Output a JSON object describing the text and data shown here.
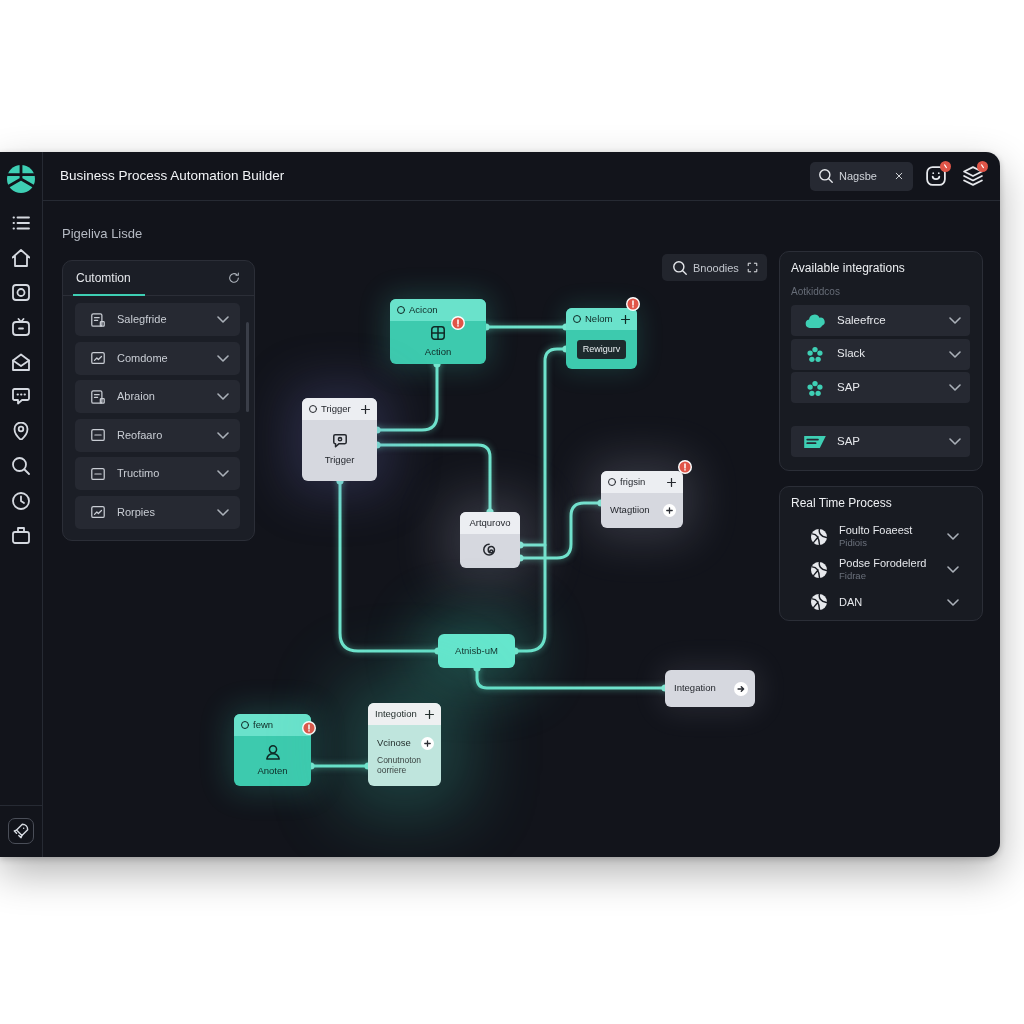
{
  "window": {
    "title": "Business Process Automation Builder"
  },
  "header": {
    "search": {
      "placeholder": "Nagsbe"
    },
    "buttons": [
      {
        "alert": true
      },
      {
        "alert": true
      }
    ]
  },
  "section_title": "Pigeliva Lisde",
  "left_panel": {
    "tabs": [
      {
        "label": "Cutomtion",
        "selected": true
      }
    ],
    "items": [
      {
        "label": "Salegfride",
        "expanded": false
      },
      {
        "label": "Comdome",
        "expanded": false
      },
      {
        "label": "Abraion",
        "expanded": false
      },
      {
        "label": "Reofaaro",
        "expanded": false
      },
      {
        "label": "Tructimo",
        "expanded": false
      },
      {
        "label": "Rorpies",
        "expanded": false
      }
    ]
  },
  "canvas": {
    "search": {
      "placeholder": "Bnoodies"
    },
    "nodes": [
      {
        "kind": "action",
        "header": "Acicon",
        "label": "Action",
        "alert": true
      },
      {
        "kind": "action",
        "header": "Nelom",
        "chip": "Rewigurv",
        "alert": true
      },
      {
        "kind": "trigger",
        "header": "Trigger",
        "label": "Trigger",
        "alert": false
      },
      {
        "kind": "trigger",
        "header": "Artqurovo",
        "alert": false
      },
      {
        "kind": "trigger",
        "header": "frigsin",
        "label": "Wtagtiion",
        "alert": true
      },
      {
        "kind": "highlight",
        "label": "Atnisb-uM",
        "alert": false
      },
      {
        "kind": "trigger",
        "label": "Integation",
        "alert": false
      },
      {
        "kind": "action",
        "header": "fewn",
        "label": "Anoten",
        "alert": true
      },
      {
        "kind": "integration",
        "header": "Integotion",
        "label": "Vcinose",
        "note": "Conutnoton oorriere",
        "alert": false
      }
    ]
  },
  "integrations": {
    "title": "Available integrations",
    "subtitle": "Aotkiddcos",
    "groups": [
      {
        "items": [
          {
            "label": "Saleefrce",
            "expanded": false
          },
          {
            "label": "Slack",
            "expanded": false
          },
          {
            "label": "SAP",
            "expanded": false
          }
        ]
      },
      {
        "items": [
          {
            "label": "SAP",
            "expanded": false
          }
        ]
      }
    ]
  },
  "real_time": {
    "title": "Real Time Process",
    "items": [
      {
        "title": "Foulto Foaeest",
        "subtitle": "Pidiois",
        "expanded": false
      },
      {
        "title": "Podse Forodelerd",
        "subtitle": "Fidrae",
        "expanded": false
      },
      {
        "title": "DAN",
        "expanded": false
      }
    ]
  }
}
